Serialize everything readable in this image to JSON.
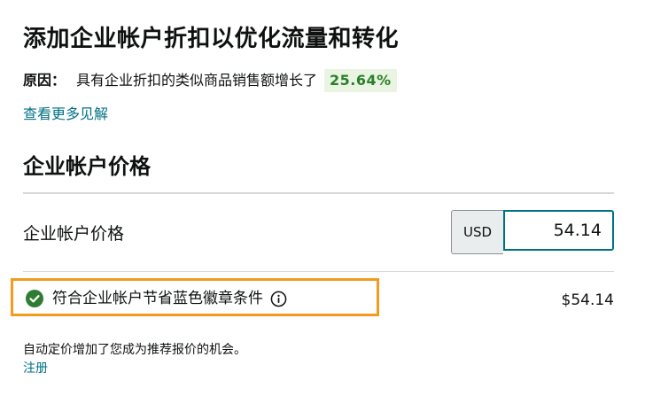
{
  "header": {
    "title": "添加企业帐户折扣以优化流量和转化"
  },
  "reason": {
    "label": "原因：",
    "text": "具有企业折扣的类似商品销售额增长了",
    "percent": "25.64%"
  },
  "insights_link": "查看更多见解",
  "section": {
    "title": "企业帐户价格"
  },
  "price_row": {
    "label": "企业帐户价格",
    "currency": "USD",
    "value": "54.14"
  },
  "badge_row": {
    "text": "符合企业帐户节省蓝色徽章条件",
    "price": "$54.14",
    "check_icon": "check-circle-icon",
    "info_icon": "info-icon"
  },
  "footer": {
    "note": "自动定价增加了您成为推荐报价的机会。",
    "register_link": "注册"
  },
  "colors": {
    "link": "#007185",
    "highlight_border": "#f29b1d",
    "percent_text": "#2a7f2a",
    "percent_bg": "#eaf4e2",
    "check_green": "#2e7d32"
  }
}
